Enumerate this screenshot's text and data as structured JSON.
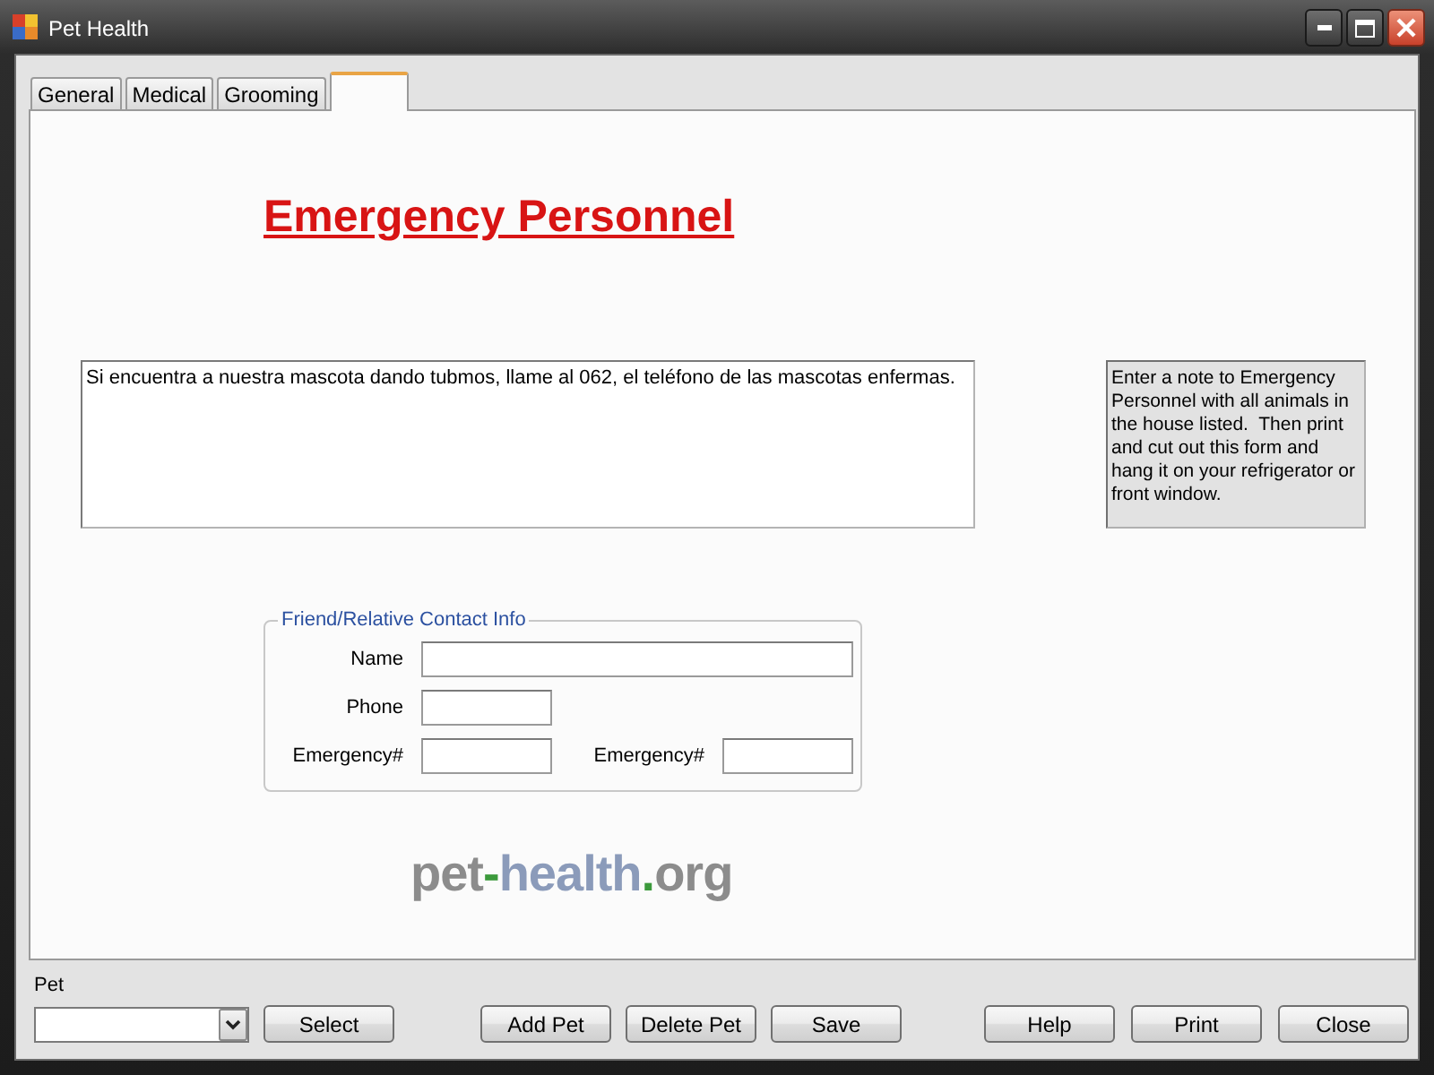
{
  "window": {
    "title": "Pet Health"
  },
  "tabs": [
    {
      "label": "General",
      "selected": false
    },
    {
      "label": "Medical",
      "selected": false
    },
    {
      "label": "Grooming",
      "selected": false
    },
    {
      "selected": true
    }
  ],
  "panel": {
    "heading": "Emergency Personnel",
    "note": {
      "value": "Si encuentra a nuestra mascota dando tubmos, llame al 062, el teléfono de las mascotas enfermas."
    },
    "help_text": "Enter a note to Emergency Personnel with all animals in the house listed.  Then print and cut out this form and hang it on your refrigerator or front window.",
    "contact_group": {
      "title": "Friend/Relative Contact Info",
      "rows": [
        [
          {
            "label": "Name",
            "kind": "wide"
          }
        ],
        [
          {
            "label": "Phone",
            "kind": "short"
          }
        ],
        [
          {
            "label": "Emergency#",
            "kind": "short"
          },
          {
            "label": "Emergency#",
            "kind": "short"
          }
        ]
      ]
    },
    "logo": {
      "parts": [
        {
          "text": "pet",
          "kind": "base"
        },
        {
          "text": "-",
          "kind": "accent"
        },
        {
          "text": "health",
          "kind": "tint"
        },
        {
          "text": ".",
          "kind": "accent"
        },
        {
          "text": "org",
          "kind": "base"
        }
      ]
    }
  },
  "bottom": {
    "pet_label": "Pet",
    "select_button": "Select",
    "pet_actions": [
      "Add Pet",
      "Delete Pet",
      "Save"
    ],
    "dialog_buttons": [
      "Help",
      "Print",
      "Close"
    ]
  }
}
